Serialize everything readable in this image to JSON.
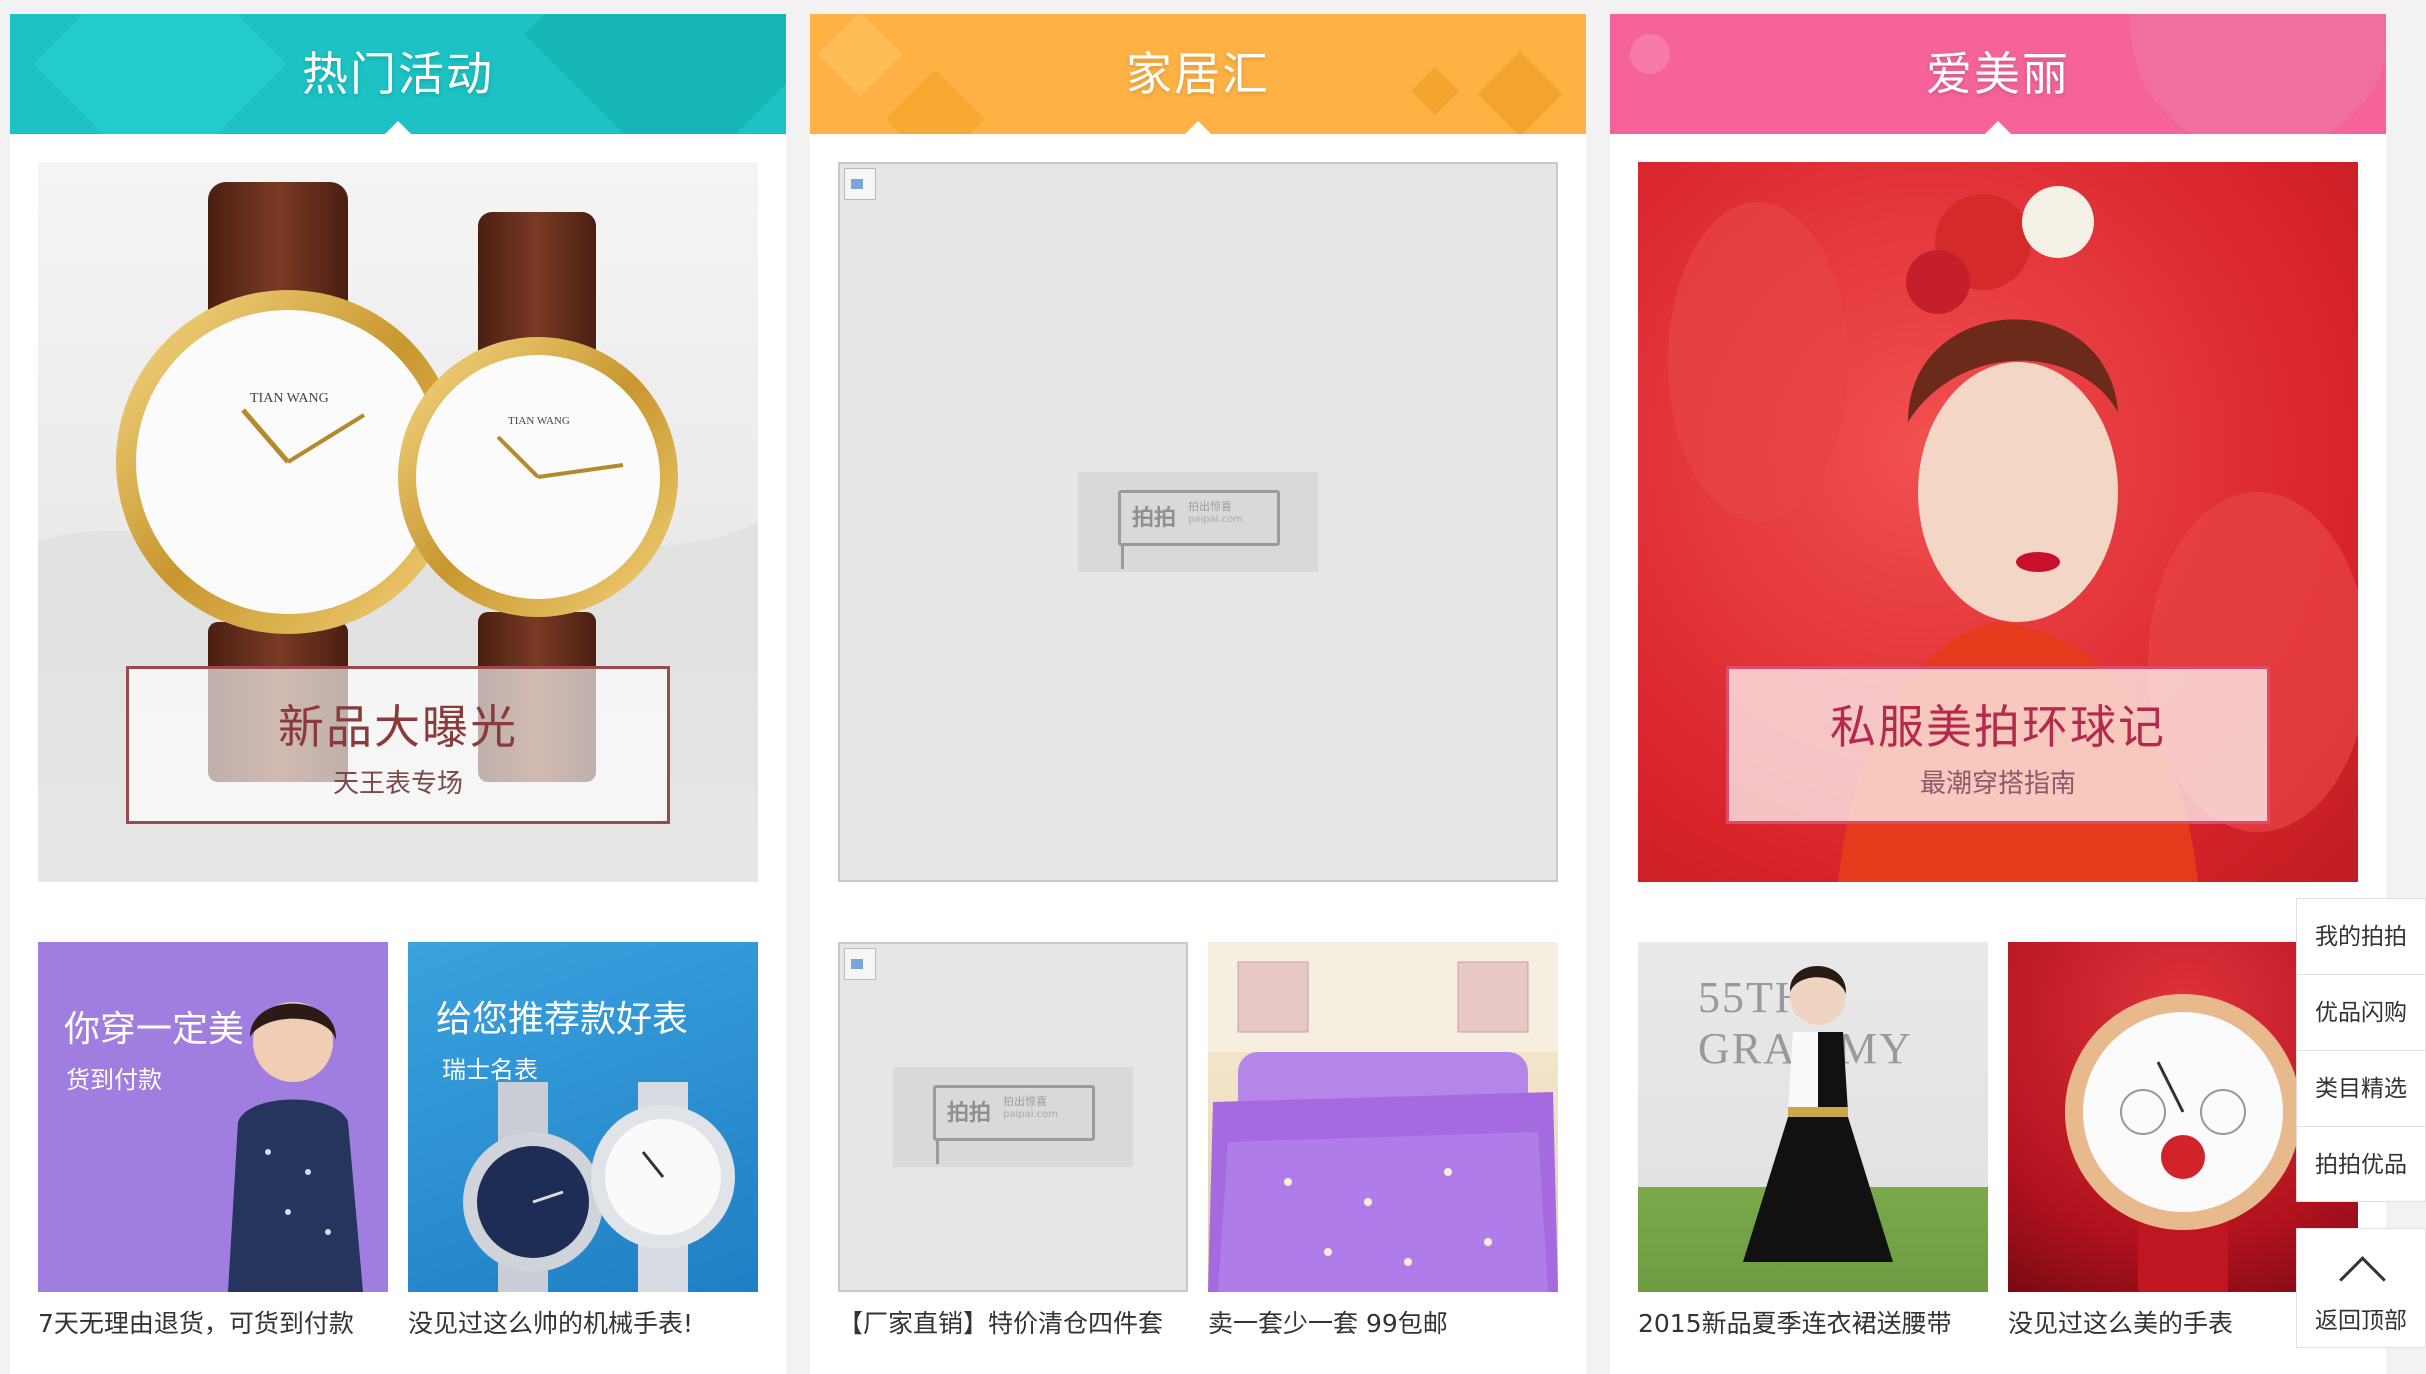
{
  "columns": [
    {
      "title": "热门活动",
      "header_color": "#1cc2c4",
      "banner": {
        "headline": "新品大曝光",
        "subline": "天王表专场",
        "watch_brand": "TIAN WANG"
      },
      "promo_left": {
        "headline": "你穿一定美",
        "subline": "货到付款"
      },
      "promo_right": {
        "headline": "给您推荐款好表",
        "subline": "瑞士名表"
      },
      "captions": [
        "7天无理由退货，可货到付款",
        "没见过这么帅的机械手表!"
      ]
    },
    {
      "title": "家居汇",
      "header_color": "#ffb143",
      "placeholder": {
        "logo": "拍拍",
        "logo_sub": "拍出惊喜",
        "logo_url": "paipai.com"
      },
      "captions": [
        "【厂家直销】特价清仓四件套",
        "卖一套少一套 99包邮"
      ]
    },
    {
      "title": "爱美丽",
      "header_color": "#f5639a",
      "banner": {
        "headline": "私服美拍环球记",
        "subline": "最潮穿搭指南"
      },
      "poster_text": "55TH GRAMMY",
      "captions": [
        "2015新品夏季连衣裙送腰带",
        "没见过这么美的手表"
      ]
    }
  ],
  "sidebar": {
    "items": [
      "我的拍拍",
      "优品闪购",
      "类目精选",
      "拍拍优品"
    ],
    "back_to_top": "返回顶部"
  }
}
